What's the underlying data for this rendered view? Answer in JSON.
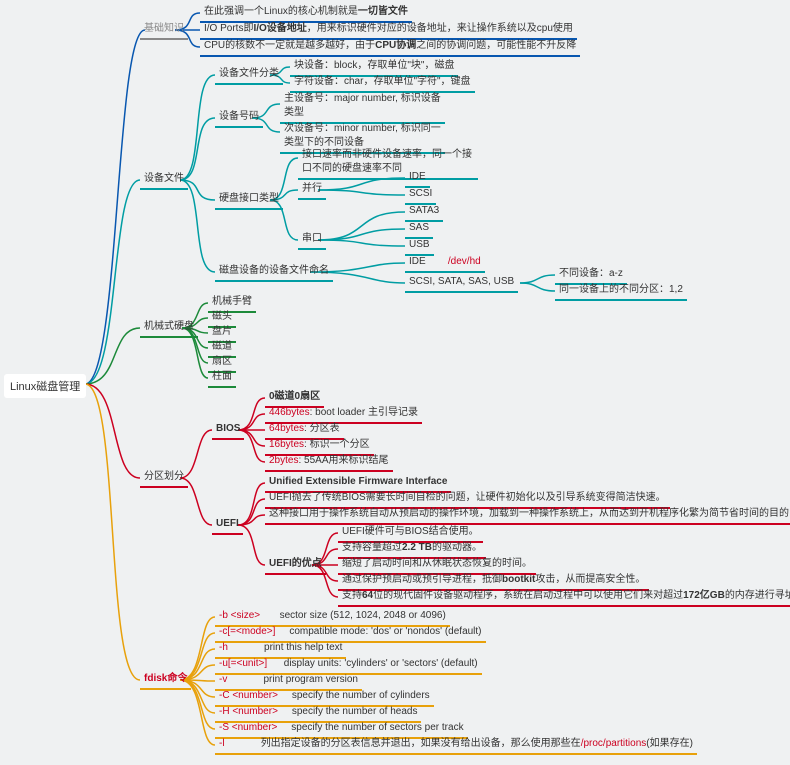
{
  "root": "Linux磁盘管理",
  "basic": {
    "label": "基础知识",
    "n1_pre": "在此强调一个Linux的核心机制就是",
    "n1_bold": "一切皆文件",
    "n2_pre": "I/O Ports即",
    "n2_bold": "I/O设备地址",
    "n2_post": "，用来标识硬件对应的设备地址，来让操作系统以及cpu使用",
    "n3_pre": "CPU的核数不一定就是越多越好，由于",
    "n3_bold": "CPU协调",
    "n3_post": "之间的协调问题，可能性能不升反降"
  },
  "devfile": {
    "label": "设备文件",
    "cls": {
      "label": "设备文件分类",
      "block": "块设备：block，存取单位\"块\"，磁盘",
      "char": "字符设备：char，存取单位\"字符\"，键盘"
    },
    "num": {
      "label": "设备号码",
      "major": "主设备号：major number, 标识设备类型",
      "minor": "次设备号：minor number, 标识同一类型下的不同设备"
    },
    "iface": {
      "label": "硬盘接口类型",
      "desc": "接口速率而非硬件设备速率，同一个接口不同的硬盘速率不同",
      "parallel": "并行",
      "serial": "串口",
      "ide": "IDE",
      "scsi": "SCSI",
      "sata3": "SATA3",
      "sas": "SAS",
      "usb": "USB"
    },
    "naming": {
      "label": "磁盘设备的设备文件命名",
      "ide": "IDE",
      "ide_path": "/dev/hd",
      "scsi": "SCSI, SATA, SAS, USB",
      "dev": "不同设备：a-z",
      "part": "同一设备上的不同分区：1,2"
    }
  },
  "mech": {
    "label": "机械式硬盘",
    "arm": "机械手臂",
    "head": "磁头",
    "platter": "盘片",
    "track": "磁道",
    "sector": "扇区",
    "cylinder": "柱面"
  },
  "partition": {
    "label": "分区划分",
    "bios": {
      "label": "BIOS",
      "zero": "0磁道0扇区",
      "boot_size": "446bytes",
      "boot": ": boot loader 主引导记录",
      "table_size": "64bytes",
      "table": ": 分区表",
      "part_size": "16bytes",
      "part": ": 标识一个分区",
      "end_size": "2bytes",
      "end": ": 55AA用来标识结尾"
    },
    "uefi": {
      "label": "UEFI",
      "full": "Unified Extensible Firmware Interface",
      "desc1": "UEFI抛去了传统BIOS需要长时间自检的问题，让硬件初始化以及引导系统变得简洁快速。",
      "desc2": "这种接口用于操作系统自动从预启动的操作环境，加载到一种操作系统上，从而达到开机程序化繁为简节省时间的目的",
      "adv_label": "UEFI的优点",
      "adv1": "UEFI硬件可与BIOS结合使用。",
      "adv2_pre": "支持容量超过",
      "adv2_bold": "2.2 TB",
      "adv2_post": "的驱动器。",
      "adv3": "缩短了启动时间和从休眠状态恢复的时间。",
      "adv4_pre": "通过保护预启动或预引导进程，抵御",
      "adv4_bold": "bootkit",
      "adv4_post": "攻击，从而提高安全性。",
      "adv5_pre": "支持",
      "adv5_bold1": "64",
      "adv5_mid": "位的现代固件设备驱动程序，系统在启动过程中可以使用它们来对超过",
      "adv5_bold2": "172亿GB",
      "adv5_post": "的内存进行寻址。"
    }
  },
  "fdisk": {
    "label": "fdisk命令",
    "b_flag": "-b <size>",
    "b_desc": "sector size (512, 1024, 2048 or 4096)",
    "c_flag": "-c[=<mode>]",
    "c_desc": "compatible mode: 'dos' or 'nondos' (default)",
    "h_flag": "-h",
    "h_desc": "print this help text",
    "u_flag": "-u[=<unit>]",
    "u_desc": "display units: 'cylinders' or 'sectors' (default)",
    "v_flag": "-v",
    "v_desc": "print program version",
    "C_flag": "-C <number>",
    "C_desc": "specify the number of cylinders",
    "H_flag": "-H <number>",
    "H_desc": "specify the number of heads",
    "S_flag": "-S <number>",
    "S_desc": "specify the number of sectors per track",
    "l_flag": "-l",
    "l_desc_pre": "列出指定设备的分区表信息并退出，如果没有给出设备，那么使用那些在",
    "l_desc_path": "/proc/partitions",
    "l_desc_post": "(如果存在)"
  }
}
